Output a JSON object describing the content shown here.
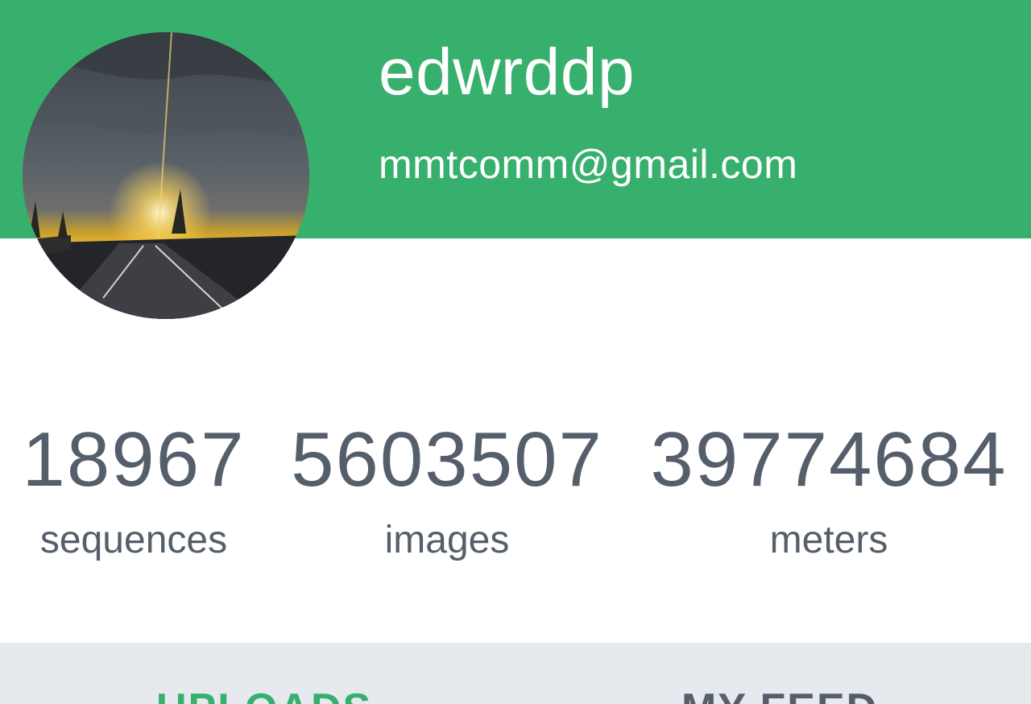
{
  "profile": {
    "username": "edwrddp",
    "email": "mmtcomm@gmail.com"
  },
  "stats": [
    {
      "value": "18967",
      "label": "sequences"
    },
    {
      "value": "5603507",
      "label": "images"
    },
    {
      "value": "39774684",
      "label": "meters"
    }
  ],
  "tabs": {
    "uploads": "UPLOADS",
    "feed": "MY FEED",
    "active": "UPLOADS"
  },
  "colors": {
    "brand_green": "#38b06d",
    "stat_text": "#555f6b",
    "tab_bar_bg": "#e6e9ed"
  }
}
